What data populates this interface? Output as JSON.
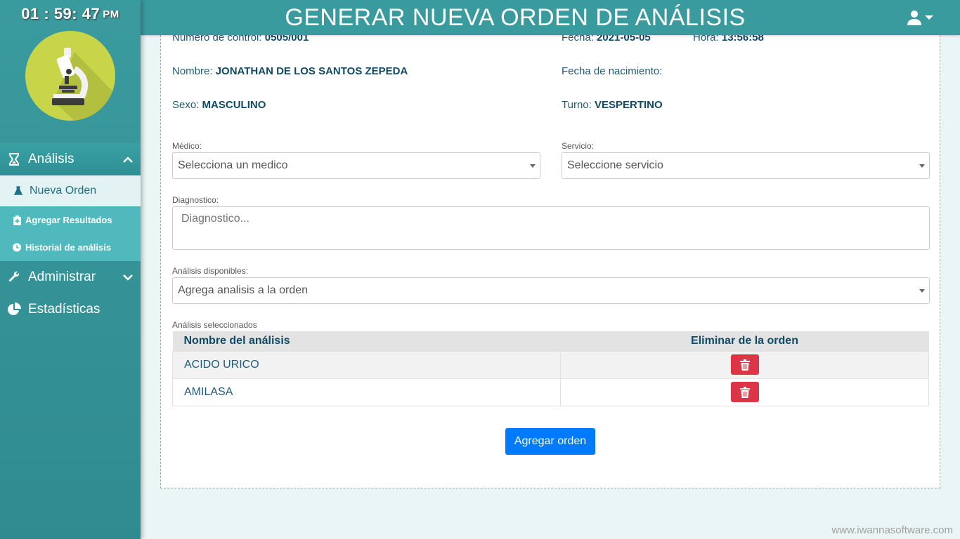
{
  "clock": {
    "time": "01 : 59: 47",
    "ampm": "PM"
  },
  "header": {
    "title": "GENERAR NUEVA ORDEN DE ANÁLISIS"
  },
  "sidebar": {
    "sections": [
      {
        "label": "Análisis",
        "icon": "hourglass-icon"
      },
      {
        "label": "Administrar",
        "icon": "wrench-icon"
      },
      {
        "label": "Estadísticas",
        "icon": "pie-chart-icon"
      }
    ],
    "sub_items": [
      {
        "label": "Nueva Orden",
        "icon": "flask-icon"
      },
      {
        "label": "Agregar Resultados",
        "icon": "clipboard-plus-icon"
      },
      {
        "label": "Historial de análisis",
        "icon": "clock-icon"
      }
    ]
  },
  "patient": {
    "control_label": "Número de control:",
    "control_value": "0505/001",
    "fecha_label": "Fecha:",
    "fecha_value": "2021-05-05",
    "hora_label": "Hora:",
    "hora_value": "13:56:58",
    "nombre_label": "Nombre:",
    "nombre_value": "JONATHAN DE LOS SANTOS ZEPEDA",
    "nacimiento_label": "Fecha de nacimiento:",
    "nacimiento_value": "",
    "sexo_label": "Sexo:",
    "sexo_value": "MASCULINO",
    "turno_label": "Turno:",
    "turno_value": "VESPERTINO"
  },
  "form": {
    "medico_label": "Médico:",
    "medico_value": "Selecciona un medico",
    "servicio_label": "Servicio:",
    "servicio_value": "Seleccione servicio",
    "diagnostico_label": "Diagnostico:",
    "diagnostico_placeholder": "Diagnostico...",
    "analisis_label": "Análisis disponibles:",
    "analisis_value": "Agrega analisis a la orden",
    "seleccionados_label": "Análisis seleccionados"
  },
  "table": {
    "headers": [
      "Nombre del análisis",
      "Eliminar de la orden"
    ],
    "rows": [
      {
        "name": "ACIDO URICO"
      },
      {
        "name": "AMILASA"
      }
    ]
  },
  "actions": {
    "submit_label": "Agregar orden"
  },
  "footer": {
    "text": "www.iwannasoftware.com"
  },
  "colors": {
    "teal": "#3a9b9e",
    "danger": "#dc3545",
    "primary": "#007bff",
    "logo": "#c8d548"
  }
}
